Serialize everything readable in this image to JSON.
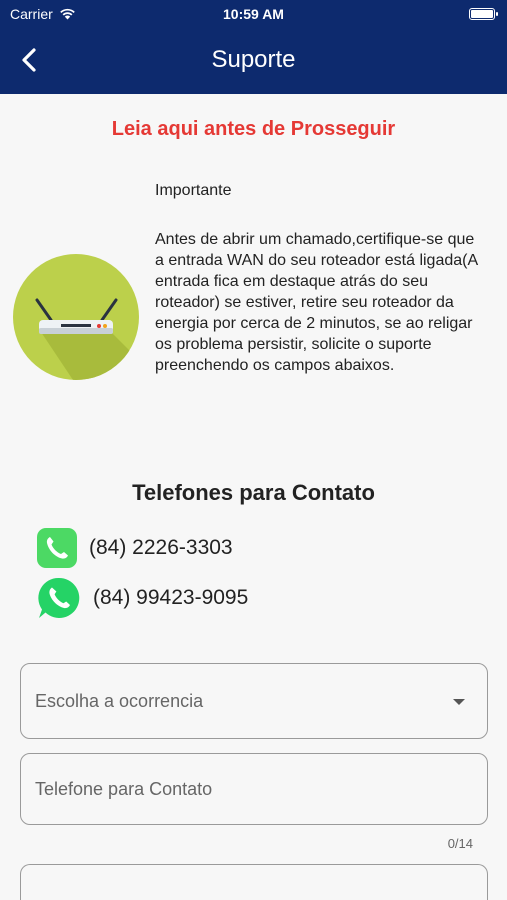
{
  "status_bar": {
    "carrier": "Carrier",
    "time": "10:59 AM"
  },
  "nav": {
    "title": "Suporte",
    "back_icon": "chevron-left-icon"
  },
  "warning": {
    "title": "Leia aqui antes de Prosseguir"
  },
  "info": {
    "heading": "Importante",
    "body": "Antes de abrir um chamado,certifique-se que a entrada WAN do seu roteador está ligada(A entrada fica em destaque atrás do seu roteador) se estiver, retire seu roteador da energia por cerca de 2 minutos, se ao religar os problema persistir, solicite o suporte preenchendo os campos abaixos."
  },
  "contacts": {
    "title": "Telefones para Contato",
    "phone": "(84) 2226-3303",
    "whatsapp": "(84) 99423-9095"
  },
  "form": {
    "occurrence_placeholder": "Escolha a ocorrencia",
    "phone_placeholder": "Telefone para Contato",
    "phone_counter": "0/14"
  },
  "colors": {
    "header": "#0d2a6e",
    "warning": "#e53935",
    "router_bg": "#bcd04b",
    "phone_icon": "#4cd964",
    "whatsapp_icon": "#25d366"
  }
}
